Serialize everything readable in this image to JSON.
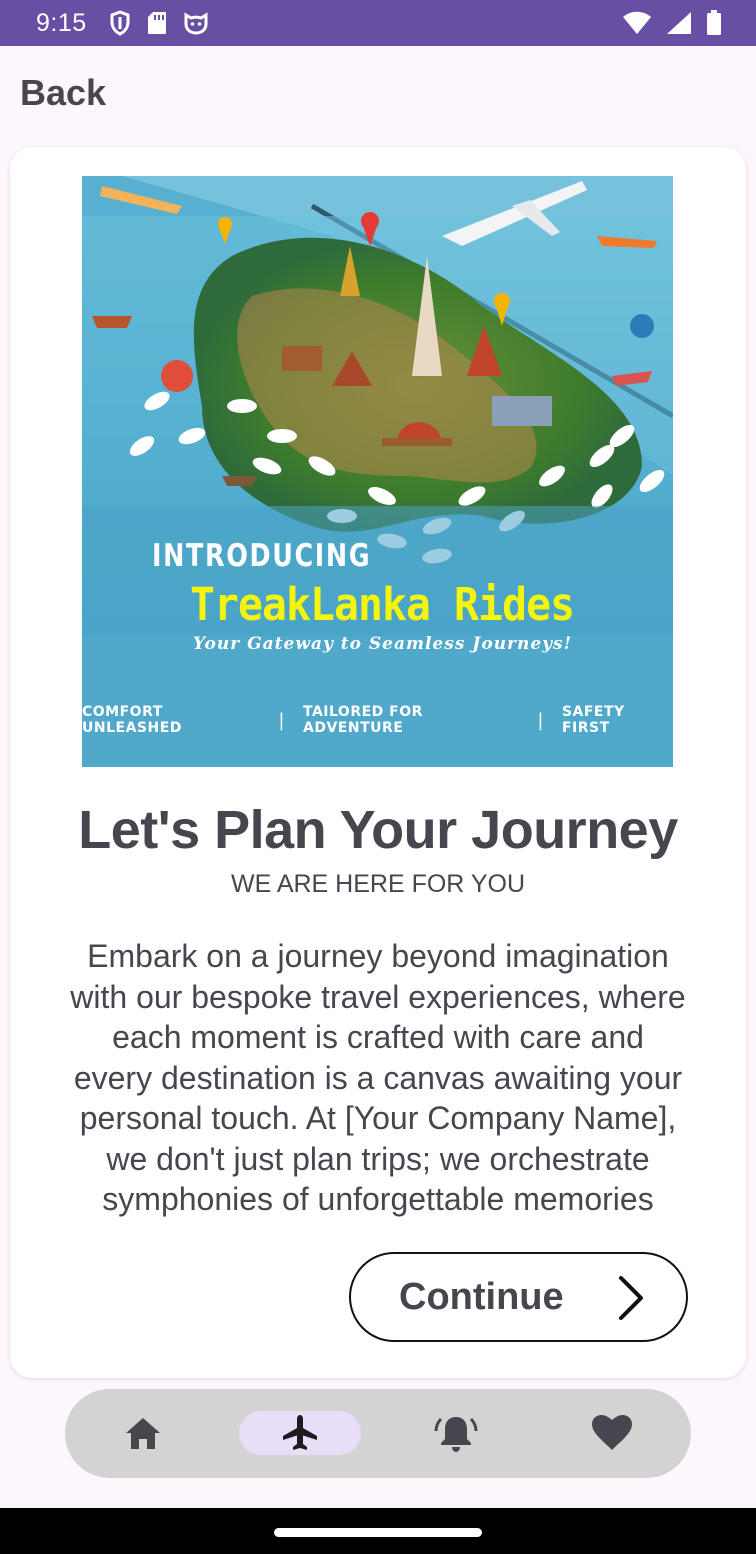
{
  "status_bar": {
    "time": "9:15",
    "left_icons": [
      "shield-icon",
      "sd-card-icon",
      "cat-face-icon"
    ],
    "right_icons": [
      "wifi-icon",
      "signal-icon",
      "battery-icon"
    ],
    "background": "#6750a4"
  },
  "header": {
    "back_label": "Back"
  },
  "hero": {
    "intro": "INTRODUCING",
    "brand": "TreakLanka Rides",
    "tagline": "Your Gateway to Seamless Journeys!",
    "features": [
      "COMFORT UNLEASHED",
      "TAILORED FOR ADVENTURE",
      "SAFETY FIRST"
    ],
    "separator": "|",
    "brand_color": "#f4f40c"
  },
  "content": {
    "title": "Let's Plan Your Journey",
    "subtitle": "WE ARE HERE FOR YOU",
    "description_lines": [
      "Embark on a journey beyond imagination",
      "with our bespoke travel experiences, where",
      "each moment is crafted with care and",
      "every destination is a canvas awaiting your",
      "personal touch. At [Your Company Name],",
      "we don't just plan trips; we orchestrate",
      "symphonies of unforgettable memories"
    ]
  },
  "continue_button": {
    "label": "Continue",
    "icon": "chevron-right-icon"
  },
  "bottom_nav": {
    "items": [
      {
        "name": "home",
        "icon": "home-icon",
        "active": false
      },
      {
        "name": "trips",
        "icon": "airplane-icon",
        "active": true
      },
      {
        "name": "notifications",
        "icon": "bell-icon",
        "active": false
      },
      {
        "name": "favorites",
        "icon": "heart-icon",
        "active": false
      }
    ],
    "active_color": "#e8def8",
    "background": "#d3d3d3"
  }
}
